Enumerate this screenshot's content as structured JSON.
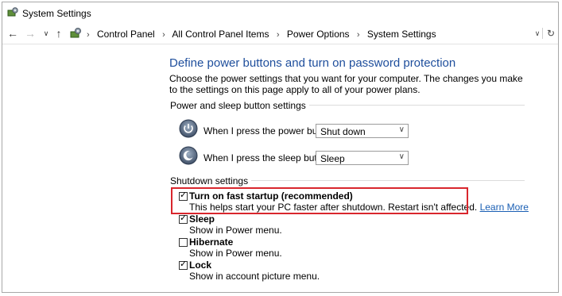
{
  "window": {
    "title": "System Settings"
  },
  "nav": {
    "back_icon": "back-arrow-icon",
    "forward_icon": "forward-arrow-icon",
    "recent_icon": "chevron-down-icon",
    "up_icon": "up-arrow-icon",
    "breadcrumb": [
      "Control Panel",
      "All Control Panel Items",
      "Power Options",
      "System Settings"
    ]
  },
  "main": {
    "heading": "Define power buttons and turn on password protection",
    "description": "Choose the power settings that you want for your computer. The changes you make to the settings on this page apply to all of your power plans."
  },
  "power_section": {
    "label": "Power and sleep button settings",
    "power_button": {
      "label": "When I press the power button:",
      "value": "Shut down"
    },
    "sleep_button": {
      "label": "When I press the sleep button:",
      "value": "Sleep"
    }
  },
  "shutdown_section": {
    "label": "Shutdown settings",
    "options": [
      {
        "title": "Turn on fast startup (recommended)",
        "desc": "This helps start your PC faster after shutdown. Restart isn't affected.",
        "link": "Learn More",
        "checked": true
      },
      {
        "title": "Sleep",
        "desc": "Show in Power menu.",
        "checked": true
      },
      {
        "title": "Hibernate",
        "desc": "Show in Power menu.",
        "checked": false
      },
      {
        "title": "Lock",
        "desc": "Show in account picture menu.",
        "checked": true
      }
    ]
  },
  "colors": {
    "heading": "#1e4e9c",
    "link": "#1a5fb4",
    "highlight": "#d9262d"
  }
}
